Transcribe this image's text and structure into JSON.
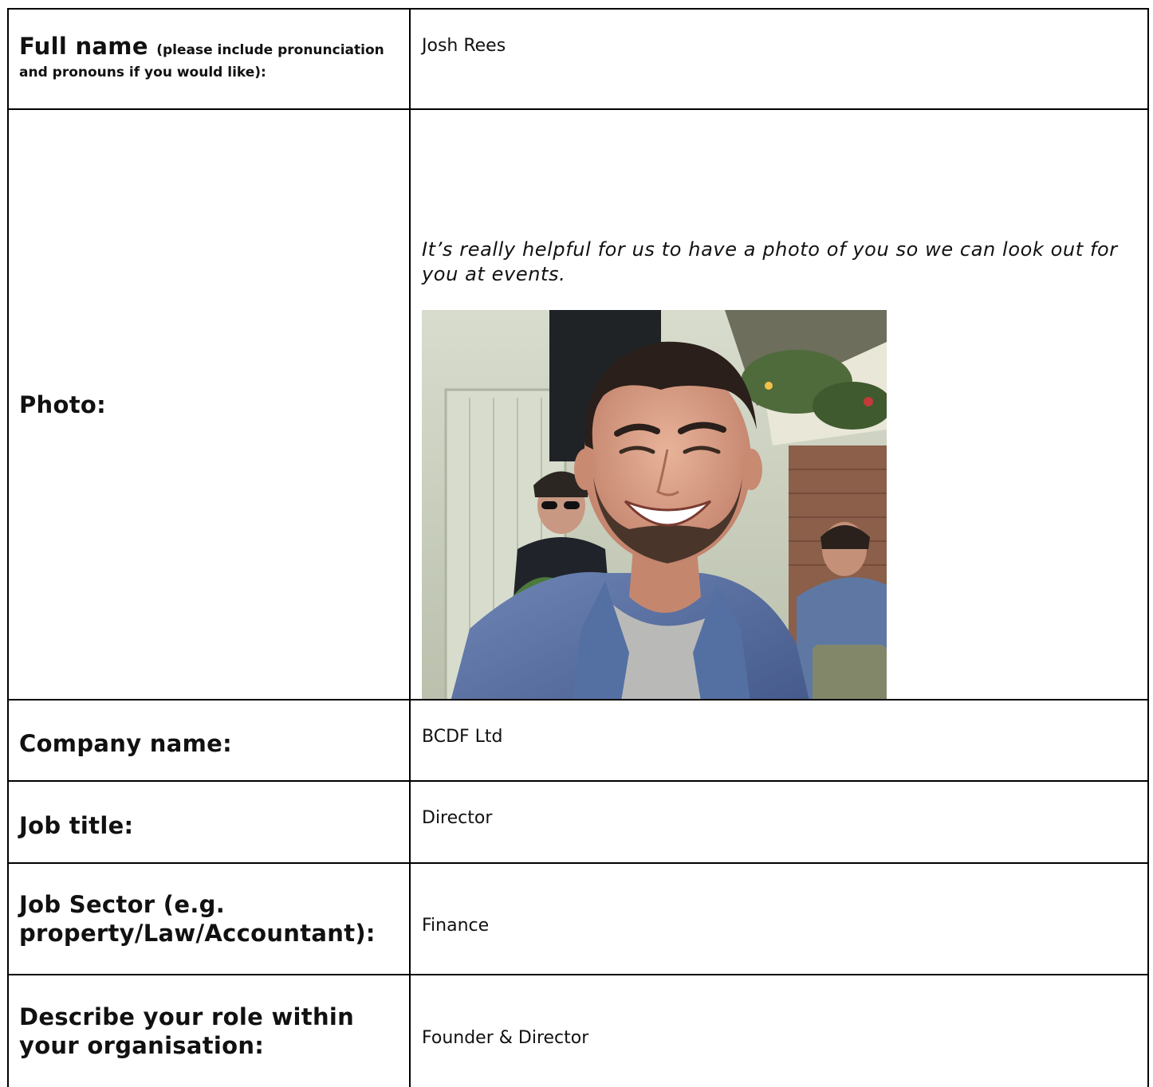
{
  "form": {
    "full_name": {
      "label": "Full name",
      "label_note": "(please include pronunciation and pronouns if you would like):",
      "value": "Josh Rees"
    },
    "photo": {
      "label": "Photo:",
      "note": "It’s really helpful for us to have a photo of you so we can look out for you at events."
    },
    "company_name": {
      "label": "Company name:",
      "value": "BCDF Ltd"
    },
    "job_title": {
      "label": "Job title:",
      "value": "Director"
    },
    "job_sector": {
      "label": "Job Sector (e.g. property/Law/Accountant):",
      "value": "Finance"
    },
    "role": {
      "label": "Describe your role within your organisation:",
      "value": "Founder & Director"
    }
  }
}
